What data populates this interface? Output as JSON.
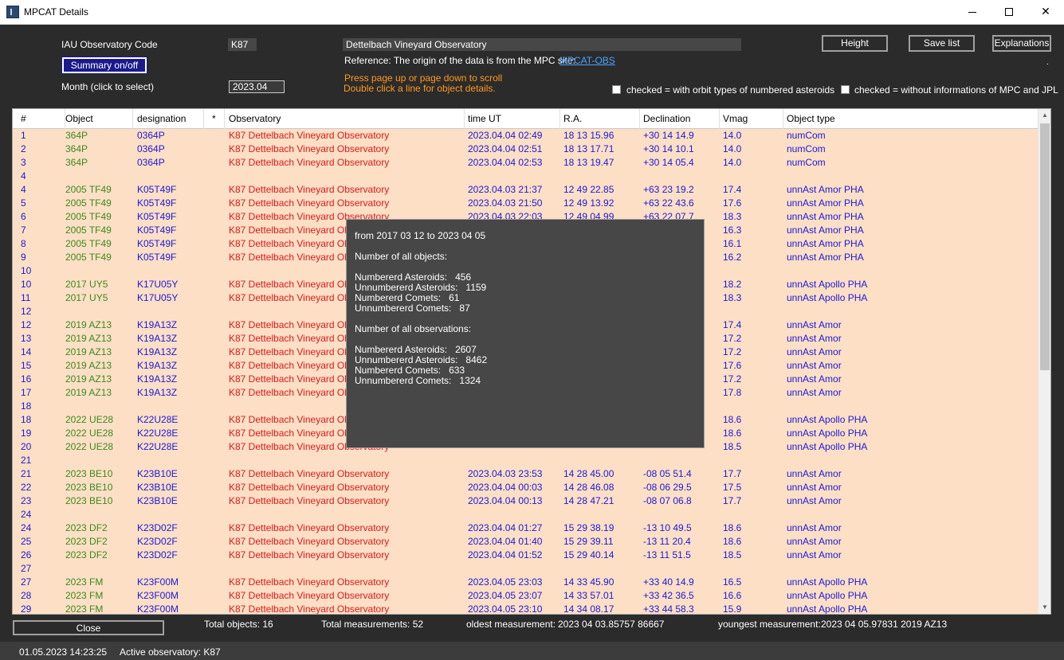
{
  "window": {
    "title": "MPCAT Details",
    "min_icon": "minimize-icon",
    "max_icon": "maximize-icon",
    "close_glyph": "✕"
  },
  "header": {
    "iau_label": "IAU Observatory Code",
    "iau_code": "K87",
    "observatory_name": "Dettelbach Vineyard Observatory",
    "summary_button": "Summary on/off",
    "reference_text": "Reference: The origin of the data is from the MPC site:",
    "reference_link": "MPCAT-OBS",
    "month_label": "Month (click to select)",
    "month_value": "2023.04",
    "hint_line1": "Press page up or page down to scroll",
    "hint_line2": "Double click a line for object details.",
    "height_button": "Height",
    "save_button": "Save list",
    "explanations_button": "Explanations",
    "dot": ".",
    "check1_label": "checked = with orbit types of numbered asteroids",
    "check2_label": "checked = without informations of MPC and JPL"
  },
  "columns": [
    "#",
    "Object",
    "designation",
    "*",
    "Observatory",
    "time UT",
    "R.A.",
    "Declination",
    "Vmag",
    "Object type"
  ],
  "rows": [
    {
      "n": "1",
      "obj": "364P",
      "des": "0364P",
      "obs": "K87  Dettelbach Vineyard Observatory",
      "time": "2023.04.04  02:49",
      "ra": "18 13 15.96",
      "dec": "+30 14 14.9",
      "vmag": "14.0",
      "type": "numCom"
    },
    {
      "n": "2",
      "obj": "364P",
      "des": "0364P",
      "obs": "K87  Dettelbach Vineyard Observatory",
      "time": "2023.04.04  02:51",
      "ra": "18 13 17.71",
      "dec": "+30 14 10.1",
      "vmag": "14.0",
      "type": "numCom"
    },
    {
      "n": "3",
      "obj": "364P",
      "des": "0364P",
      "obs": "K87  Dettelbach Vineyard Observatory",
      "time": "2023.04.04  02:53",
      "ra": "18 13 19.47",
      "dec": "+30 14 05.4",
      "vmag": "14.0",
      "type": "numCom"
    },
    {
      "n": "4",
      "obj": "",
      "des": "",
      "obs": "",
      "time": "",
      "ra": "",
      "dec": "",
      "vmag": "",
      "type": ""
    },
    {
      "n": "4",
      "obj": "2005 TF49",
      "des": "K05T49F",
      "obs": "K87  Dettelbach Vineyard Observatory",
      "time": "2023.04.03  21:37",
      "ra": "12 49 22.85",
      "dec": "+63 23 19.2",
      "vmag": "17.4",
      "type": "unnAst  Amor  PHA"
    },
    {
      "n": "5",
      "obj": "2005 TF49",
      "des": "K05T49F",
      "obs": "K87  Dettelbach Vineyard Observatory",
      "time": "2023.04.03  21:50",
      "ra": "12 49 13.92",
      "dec": "+63 22 43.6",
      "vmag": "17.6",
      "type": "unnAst  Amor  PHA"
    },
    {
      "n": "6",
      "obj": "2005 TF49",
      "des": "K05T49F",
      "obs": "K87  Dettelbach Vineyard Observatory",
      "time": "2023.04.03  22:03",
      "ra": "12 49 04.99",
      "dec": "+63 22 07.7",
      "vmag": "18.3",
      "type": "unnAst  Amor  PHA"
    },
    {
      "n": "7",
      "obj": "2005 TF49",
      "des": "K05T49F",
      "obs": "K87  Dettelbach Vineyard Obse",
      "time": "",
      "ra": "",
      "dec": "",
      "vmag": "16.3",
      "type": "unnAst  Amor  PHA"
    },
    {
      "n": "8",
      "obj": "2005 TF49",
      "des": "K05T49F",
      "obs": "K87  Dettelbach Vineyard Obse",
      "time": "",
      "ra": "",
      "dec": "",
      "vmag": "16.1",
      "type": "unnAst  Amor  PHA"
    },
    {
      "n": "9",
      "obj": "2005 TF49",
      "des": "K05T49F",
      "obs": "K87  Dettelbach Vineyard Obse",
      "time": "",
      "ra": "",
      "dec": "",
      "vmag": "16.2",
      "type": "unnAst  Amor  PHA"
    },
    {
      "n": "10",
      "obj": "",
      "des": "",
      "obs": "",
      "time": "",
      "ra": "",
      "dec": "",
      "vmag": "",
      "type": ""
    },
    {
      "n": "10",
      "obj": "2017 UY5",
      "des": "K17U05Y",
      "obs": "K87  Dettelbach Vineyard Obse",
      "time": "",
      "ra": "",
      "dec": "",
      "vmag": "18.2",
      "type": "unnAst  Apollo  PHA"
    },
    {
      "n": "11",
      "obj": "2017 UY5",
      "des": "K17U05Y",
      "obs": "K87  Dettelbach Vineyard Obse",
      "time": "",
      "ra": "",
      "dec": "",
      "vmag": "18.3",
      "type": "unnAst  Apollo  PHA"
    },
    {
      "n": "12",
      "obj": "",
      "des": "",
      "obs": "",
      "time": "",
      "ra": "",
      "dec": "",
      "vmag": "",
      "type": ""
    },
    {
      "n": "12",
      "obj": "2019 AZ13",
      "des": "K19A13Z",
      "obs": "K87  Dettelbach Vineyard Obse",
      "time": "",
      "ra": "",
      "dec": "",
      "vmag": "17.4",
      "type": "unnAst  Amor"
    },
    {
      "n": "13",
      "obj": "2019 AZ13",
      "des": "K19A13Z",
      "obs": "K87  Dettelbach Vineyard Obse",
      "time": "",
      "ra": "",
      "dec": "",
      "vmag": "17.2",
      "type": "unnAst  Amor"
    },
    {
      "n": "14",
      "obj": "2019 AZ13",
      "des": "K19A13Z",
      "obs": "K87  Dettelbach Vineyard Obse",
      "time": "",
      "ra": "",
      "dec": "",
      "vmag": "17.2",
      "type": "unnAst  Amor"
    },
    {
      "n": "15",
      "obj": "2019 AZ13",
      "des": "K19A13Z",
      "obs": "K87  Dettelbach Vineyard Obse",
      "time": "",
      "ra": "",
      "dec": "",
      "vmag": "17.6",
      "type": "unnAst  Amor"
    },
    {
      "n": "16",
      "obj": "2019 AZ13",
      "des": "K19A13Z",
      "obs": "K87  Dettelbach Vineyard Obse",
      "time": "",
      "ra": "",
      "dec": "",
      "vmag": "17.2",
      "type": "unnAst  Amor"
    },
    {
      "n": "17",
      "obj": "2019 AZ13",
      "des": "K19A13Z",
      "obs": "K87  Dettelbach Vineyard Obse",
      "time": "",
      "ra": "",
      "dec": "",
      "vmag": "17.8",
      "type": "unnAst  Amor"
    },
    {
      "n": "18",
      "obj": "",
      "des": "",
      "obs": "",
      "time": "",
      "ra": "",
      "dec": "",
      "vmag": "",
      "type": ""
    },
    {
      "n": "18",
      "obj": "2022 UE28",
      "des": "K22U28E",
      "obs": "K87  Dettelbach Vineyard Obse",
      "time": "",
      "ra": "",
      "dec": "",
      "vmag": "18.6",
      "type": "unnAst  Apollo  PHA"
    },
    {
      "n": "19",
      "obj": "2022 UE28",
      "des": "K22U28E",
      "obs": "K87  Dettelbach Vineyard Obse",
      "time": "",
      "ra": "",
      "dec": "",
      "vmag": "18.6",
      "type": "unnAst  Apollo  PHA"
    },
    {
      "n": "20",
      "obj": "2022 UE28",
      "des": "K22U28E",
      "obs": "K87  Dettelbach Vineyard Observatory",
      "time": "",
      "ra": "",
      "dec": "",
      "vmag": "18.5",
      "type": "unnAst  Apollo  PHA"
    },
    {
      "n": "21",
      "obj": "",
      "des": "",
      "obs": "",
      "time": "",
      "ra": "",
      "dec": "",
      "vmag": "",
      "type": ""
    },
    {
      "n": "21",
      "obj": "2023 BE10",
      "des": "K23B10E",
      "obs": "K87  Dettelbach Vineyard Observatory",
      "time": "2023.04.03  23:53",
      "ra": "14 28 45.00",
      "dec": "-08 05 51.4",
      "vmag": "17.7",
      "type": "unnAst  Amor"
    },
    {
      "n": "22",
      "obj": "2023 BE10",
      "des": "K23B10E",
      "obs": "K87  Dettelbach Vineyard Observatory",
      "time": "2023.04.04  00:03",
      "ra": "14 28 46.08",
      "dec": "-08 06 29.5",
      "vmag": "17.5",
      "type": "unnAst  Amor"
    },
    {
      "n": "23",
      "obj": "2023 BE10",
      "des": "K23B10E",
      "obs": "K87  Dettelbach Vineyard Observatory",
      "time": "2023.04.04  00:13",
      "ra": "14 28 47.21",
      "dec": "-08 07 06.8",
      "vmag": "17.7",
      "type": "unnAst  Amor"
    },
    {
      "n": "24",
      "obj": "",
      "des": "",
      "obs": "",
      "time": "",
      "ra": "",
      "dec": "",
      "vmag": "",
      "type": ""
    },
    {
      "n": "24",
      "obj": "2023 DF2",
      "des": "K23D02F",
      "obs": "K87  Dettelbach Vineyard Observatory",
      "time": "2023.04.04  01:27",
      "ra": "15 29 38.19",
      "dec": "-13 10 49.5",
      "vmag": "18.6",
      "type": "unnAst  Amor"
    },
    {
      "n": "25",
      "obj": "2023 DF2",
      "des": "K23D02F",
      "obs": "K87  Dettelbach Vineyard Observatory",
      "time": "2023.04.04  01:40",
      "ra": "15 29 39.11",
      "dec": "-13 11 20.4",
      "vmag": "18.6",
      "type": "unnAst  Amor"
    },
    {
      "n": "26",
      "obj": "2023 DF2",
      "des": "K23D02F",
      "obs": "K87  Dettelbach Vineyard Observatory",
      "time": "2023.04.04  01:52",
      "ra": "15 29 40.14",
      "dec": "-13 11 51.5",
      "vmag": "18.5",
      "type": "unnAst  Amor"
    },
    {
      "n": "27",
      "obj": "",
      "des": "",
      "obs": "",
      "time": "",
      "ra": "",
      "dec": "",
      "vmag": "",
      "type": ""
    },
    {
      "n": "27",
      "obj": "2023 FM",
      "des": "K23F00M",
      "obs": "K87  Dettelbach Vineyard Observatory",
      "time": "2023.04.05  23:03",
      "ra": "14 33 45.90",
      "dec": "+33 40 14.9",
      "vmag": "16.5",
      "type": "unnAst  Apollo  PHA"
    },
    {
      "n": "28",
      "obj": "2023 FM",
      "des": "K23F00M",
      "obs": "K87  Dettelbach Vineyard Observatory",
      "time": "2023.04.05  23:07",
      "ra": "14 33 57.01",
      "dec": "+33 42 36.5",
      "vmag": "16.6",
      "type": "unnAst  Apollo  PHA"
    },
    {
      "n": "29",
      "obj": "2023 FM",
      "des": "K23F00M",
      "obs": "K87  Dettelbach Vineyard Observatory",
      "time": "2023.04.05  23:10",
      "ra": "14 34 08.17",
      "dec": "+33 44 58.3",
      "vmag": "15.9",
      "type": "unnAst  Apollo  PHA"
    }
  ],
  "summary_popup": {
    "range": "from 2017 03 12 to 2023 04 05",
    "objects_title": "Number of all objects:",
    "objects": [
      {
        "label": "Numbererd Asteroids:",
        "value": "456"
      },
      {
        "label": "Unnumbererd Asteroids:",
        "value": "1159"
      },
      {
        "label": "Numbererd Comets:",
        "value": "61"
      },
      {
        "label": "Unnumbererd Comets:",
        "value": "87"
      }
    ],
    "observations_title": "Number of all observations:",
    "observations": [
      {
        "label": "Numbererd Asteroids:",
        "value": "2607"
      },
      {
        "label": "Unnumbererd Asteroids:",
        "value": "8462"
      },
      {
        "label": "Numbererd Comets:",
        "value": "633"
      },
      {
        "label": "Unnumbererd Comets:",
        "value": "1324"
      }
    ]
  },
  "footer": {
    "close_button": "Close",
    "total_objects": "Total objects: 16",
    "total_measurements": "Total measurements: 52",
    "oldest_label": "oldest  measurement:",
    "oldest_value": "2023 04 03.85757  86667",
    "youngest_label": "youngest  measurement:",
    "youngest_value": "2023 04 05.97831  2019 AZ13"
  },
  "status": {
    "datetime": "01.05.2023 14:23:25",
    "active": "Active observatory: K87"
  },
  "colors": {
    "grid_bg": "#fddfc6",
    "number_color": "#1a1ad6",
    "object_color": "#3b8a1a",
    "observatory_color": "#e01818",
    "hint_color": "#ff9a1f",
    "link_color": "#4aa3ff"
  }
}
